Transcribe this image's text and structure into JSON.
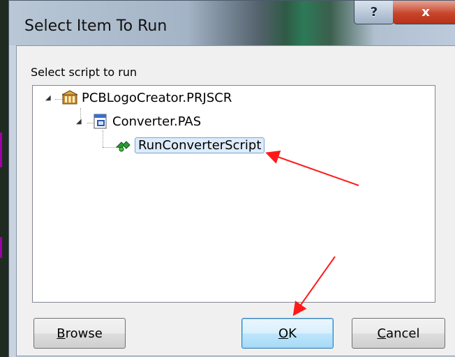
{
  "window": {
    "title": "Select Item To Run",
    "help_glyph": "?",
    "close_glyph": "x"
  },
  "dialog": {
    "group_label": "Select script to run",
    "tree": [
      {
        "label": "PCBLogoCreator.PRJSCR",
        "icon": "project-icon",
        "expanded": true
      },
      {
        "label": "Converter.PAS",
        "icon": "pascal-file-icon",
        "expanded": true
      },
      {
        "label": "RunConverterScript",
        "icon": "run-script-icon",
        "selected": true
      }
    ],
    "buttons": {
      "browse": {
        "accel": "B",
        "rest": "rowse"
      },
      "ok": {
        "accel": "O",
        "rest": "K"
      },
      "cancel": {
        "accel": "C",
        "rest": "ancel"
      }
    }
  },
  "annotation": {
    "arrow_color": "#ff1a1a",
    "arrow_count": 2
  }
}
